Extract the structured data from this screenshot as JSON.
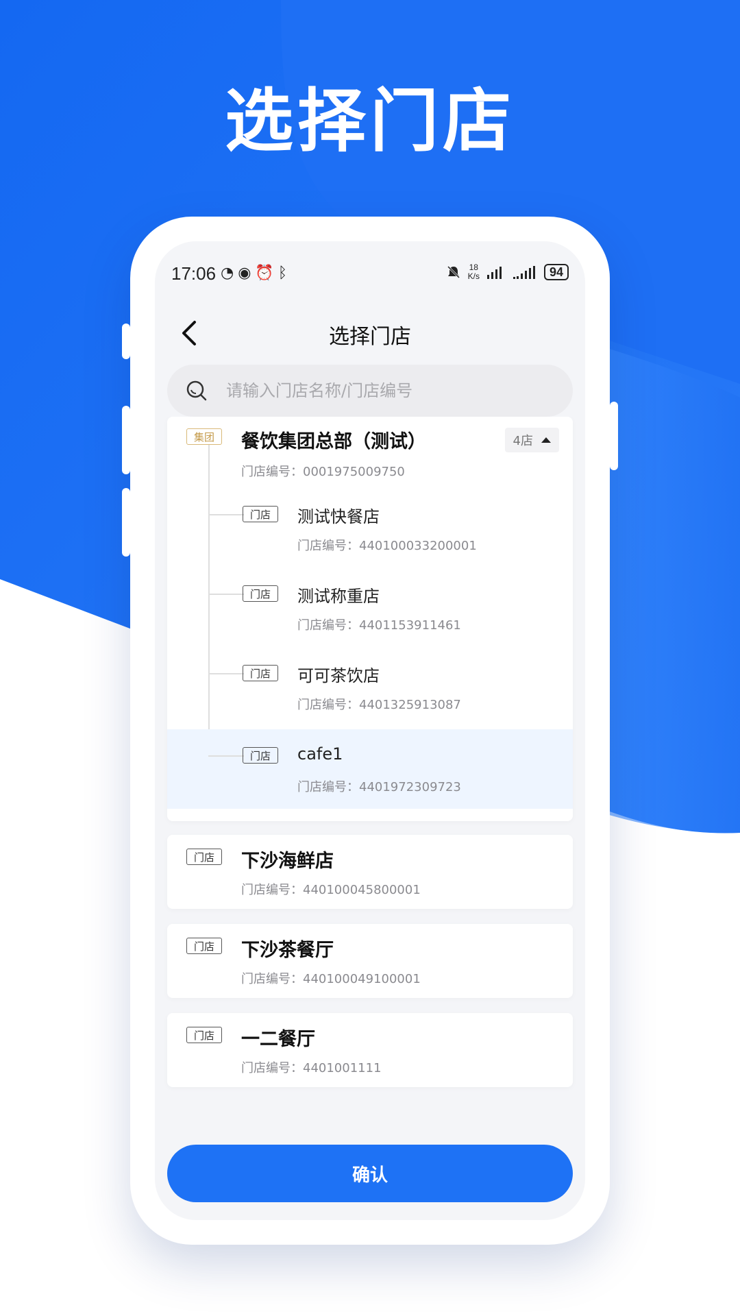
{
  "hero": {
    "title": "选择门店"
  },
  "status_bar": {
    "time": "17:06",
    "net_speed_value": "18",
    "net_speed_unit": "K/s",
    "battery": "94"
  },
  "navbar": {
    "title": "选择门店"
  },
  "search": {
    "placeholder": "请输入门店名称/门店编号"
  },
  "group": {
    "tag": "集团",
    "name": "餐饮集团总部（测试）",
    "code_label": "门店编号：",
    "code": "0001975009750",
    "count_label": "4店",
    "children": [
      {
        "tag": "门店",
        "name": "测试快餐店",
        "code_label": "门店编号：",
        "code": "440100033200001",
        "selected": false
      },
      {
        "tag": "门店",
        "name": "测试称重店",
        "code_label": "门店编号：",
        "code": "4401153911461",
        "selected": false
      },
      {
        "tag": "门店",
        "name": "可可茶饮店",
        "code_label": "门店编号：",
        "code": "4401325913087",
        "selected": false
      },
      {
        "tag": "门店",
        "name": "cafe1",
        "code_label": "门店编号：",
        "code": "4401972309723",
        "selected": true
      }
    ]
  },
  "stores": [
    {
      "tag": "门店",
      "name": "下沙海鲜店",
      "code_label": "门店编号：",
      "code": "440100045800001"
    },
    {
      "tag": "门店",
      "name": "下沙茶餐厅",
      "code_label": "门店编号：",
      "code": "440100049100001"
    },
    {
      "tag": "门店",
      "name": "一二餐厅",
      "code_label": "门店编号：",
      "code": "4401001111"
    }
  ],
  "confirm": {
    "label": "确认"
  },
  "colors": {
    "brand_blue": "#1e72f5",
    "selected_row": "#eef5ff",
    "group_tag": "#c49a4a"
  }
}
